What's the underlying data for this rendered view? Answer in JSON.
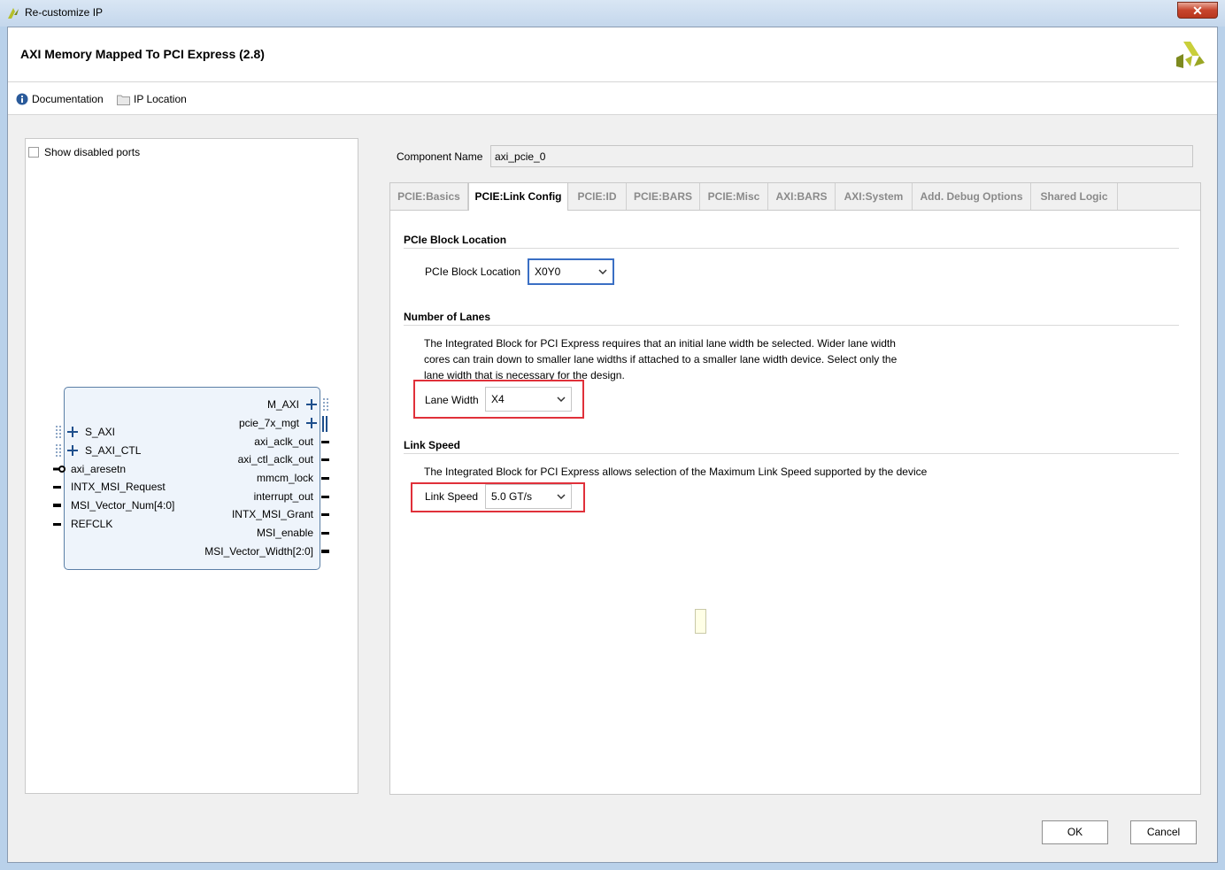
{
  "window": {
    "title": "Re-customize IP",
    "close_glyph": "✕"
  },
  "header": {
    "title": "AXI Memory Mapped To PCI Express (2.8)"
  },
  "toolbar": {
    "documentation": "Documentation",
    "ip_location": "IP Location"
  },
  "left_panel": {
    "show_disabled_ports": "Show disabled ports",
    "left_ports": [
      "S_AXI",
      "S_AXI_CTL",
      "axi_aresetn",
      "INTX_MSI_Request",
      "MSI_Vector_Num[4:0]",
      "REFCLK"
    ],
    "right_ports": [
      "M_AXI",
      "pcie_7x_mgt",
      "axi_aclk_out",
      "axi_ctl_aclk_out",
      "mmcm_lock",
      "interrupt_out",
      "INTX_MSI_Grant",
      "MSI_enable",
      "MSI_Vector_Width[2:0]"
    ]
  },
  "component": {
    "label": "Component Name",
    "value": "axi_pcie_0"
  },
  "tabs": [
    "PCIE:Basics",
    "PCIE:Link Config",
    "PCIE:ID",
    "PCIE:BARS",
    "PCIE:Misc",
    "AXI:BARS",
    "AXI:System",
    "Add. Debug Options",
    "Shared Logic"
  ],
  "active_tab": "PCIE:Link Config",
  "block_location": {
    "section": "PCIe Block Location",
    "label": "PCIe Block Location",
    "value": "X0Y0"
  },
  "lanes": {
    "section": "Number of Lanes",
    "desc1": "The Integrated Block for PCI Express requires that an initial lane width be selected. Wider lane width",
    "desc2": "cores can train down to smaller lane widths if attached to a smaller lane width device. Select only the",
    "desc3": "lane width that is necessary for the design.",
    "label": "Lane Width",
    "value": "X4"
  },
  "speed": {
    "section": "Link Speed",
    "desc": "The Integrated Block for PCI Express allows selection of the Maximum Link Speed supported by the device",
    "label": "Link Speed",
    "value": "5.0 GT/s"
  },
  "buttons": {
    "ok": "OK",
    "cancel": "Cancel"
  },
  "colors": {
    "highlight": "#e0303a",
    "focus_border": "#3a6fc4",
    "block_border": "#5b7fa6"
  }
}
